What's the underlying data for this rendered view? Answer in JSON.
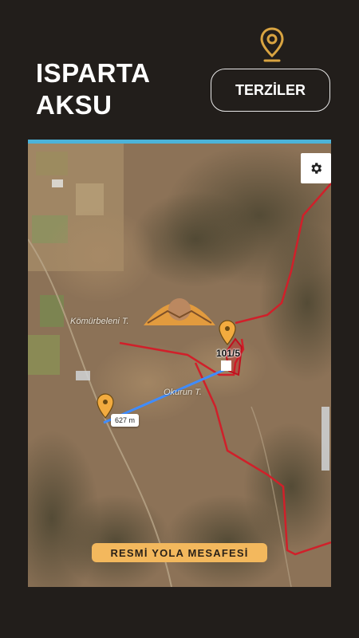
{
  "header": {
    "title_line1": "ISPARTA",
    "title_line2": "AKSU",
    "button_label": "TERZİLER",
    "accent_color": "#d9a441"
  },
  "map": {
    "place_labels": [
      "Kömürbeleni T.",
      "Okurun T."
    ],
    "plot_label": "101/5",
    "distance_label": "627 m",
    "boundary_color": "#d0202a",
    "route_color": "#3f8cff",
    "pin_color": "#f2ab3f",
    "icons": [
      "gear-icon",
      "location-pin-icon",
      "logo"
    ]
  },
  "footer": {
    "badge_label": "RESMİ YOLA MESAFESİ",
    "badge_color": "#f3b85d"
  }
}
